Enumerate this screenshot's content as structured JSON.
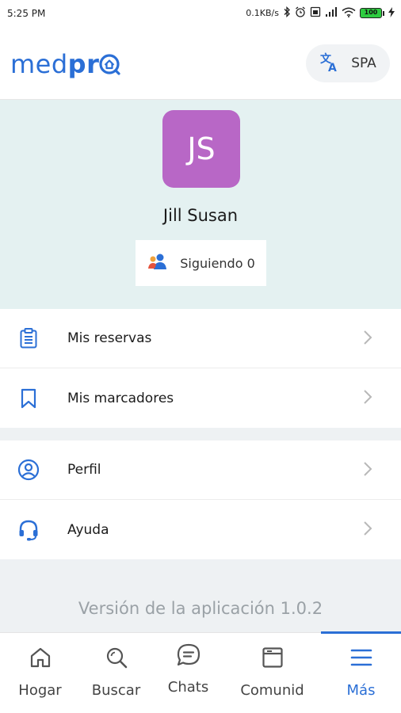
{
  "status_bar": {
    "time": "5:25 PM",
    "network_speed": "0.1KB/s",
    "battery_level": "100"
  },
  "header": {
    "logo_text_regular": "med",
    "logo_text_bold": "pr",
    "language_label": "SPA"
  },
  "profile": {
    "initials": "JS",
    "name": "Jill Susan",
    "following_label": "Siguiendo 0",
    "avatar_color": "#b867c6"
  },
  "menu": {
    "group1": [
      {
        "label": "Mis reservas",
        "icon": "clipboard-icon"
      },
      {
        "label": "Mis marcadores",
        "icon": "bookmark-icon"
      }
    ],
    "group2": [
      {
        "label": "Perfil",
        "icon": "user-circle-icon"
      },
      {
        "label": "Ayuda",
        "icon": "headset-icon"
      }
    ]
  },
  "app_version": "Versión de la aplicación 1.0.2",
  "bottom_nav": {
    "items": [
      {
        "label": "Hogar",
        "icon": "home-icon"
      },
      {
        "label": "Buscar",
        "icon": "search-icon"
      },
      {
        "label": "Chats",
        "icon": "chat-icon"
      },
      {
        "label": "Comunid",
        "icon": "community-icon"
      },
      {
        "label": "Más",
        "icon": "menu-icon",
        "active": true
      }
    ]
  },
  "colors": {
    "accent": "#2b6fd6",
    "profile_bg": "#e4f1f1",
    "band_bg": "#eef1f3"
  }
}
